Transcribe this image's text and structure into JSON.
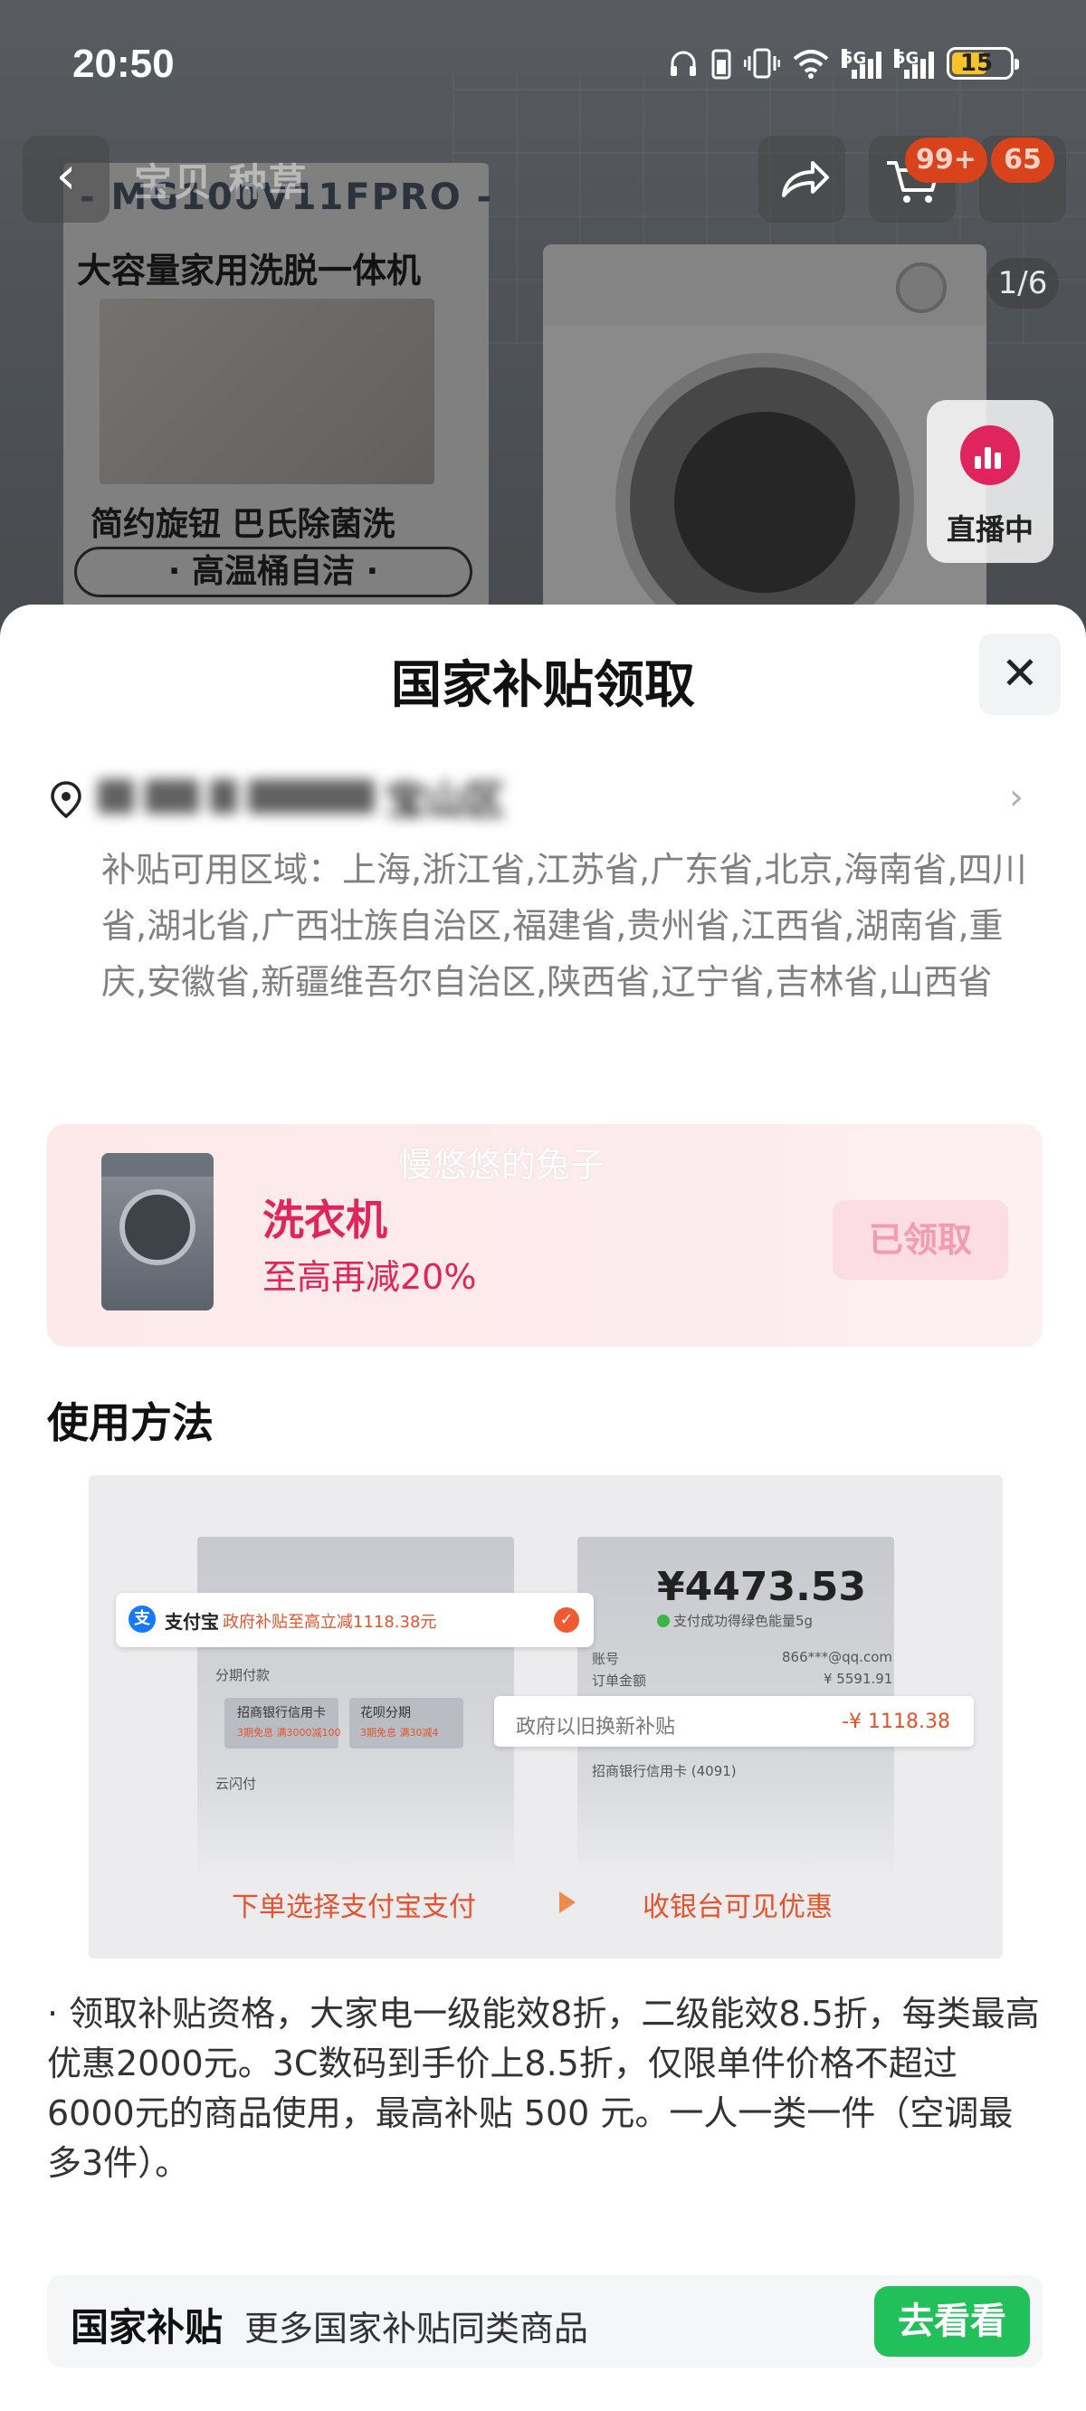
{
  "status_bar": {
    "time": "20:50",
    "network_1": "5G",
    "network_2": "5G",
    "battery": "15",
    "icons": [
      "headphones-icon",
      "phone-battery-icon",
      "vibrate-icon",
      "wifi-icon",
      "signal-icon",
      "signal-icon",
      "battery-icon"
    ]
  },
  "top_nav": {
    "tabs_text": "宝贝  种草",
    "cart_badge": "99+",
    "message_badge": "65",
    "page_indicator": "1/6",
    "live_label": "直播中"
  },
  "product_image": {
    "model": "- MG100V11FPRO -",
    "headline": "大容量家用洗脱一体机",
    "features": "简约旋钮  巴氏除菌洗",
    "pill": "· 高温桶自洁 ·"
  },
  "sheet": {
    "title": "国家补贴领取",
    "address_blurred": "宝山区",
    "region_text": "补贴可用区域：上海,浙江省,江苏省,广东省,北京,海南省,四川省,湖北省,广西壮族自治区,福建省,贵州省,江西省,湖南省,重庆,安徽省,新疆维吾尔自治区,陕西省,辽宁省,吉林省,山西省",
    "coupon": {
      "name": "洗衣机",
      "desc": "至高再减20%",
      "button": "已领取",
      "watermark": "慢悠悠的兔子"
    },
    "usage_title": "使用方法",
    "guide": {
      "alipay_name": "支付宝",
      "alipay_promo": "政府补贴至高立减1118.38元",
      "check": "✓",
      "installment": "分期付款",
      "bank_card": "招商银行信用卡",
      "bank_card_sub": "3期免息  满3000减100",
      "huabei": "花呗分期",
      "huabei_sub": "3期免息  满30减4",
      "cloud_pay": "云闪付",
      "amount": "¥4473.53",
      "amount_sub": "支付成功得绿色能量5g",
      "account_label": "账号",
      "account_value": "866***@qq.com",
      "order_label": "订单金额",
      "order_value": "¥ 5591.91",
      "subsidy_label": "政府以旧换新补贴",
      "subsidy_value": "-¥ 1118.38",
      "bank_line": "招商银行信用卡 (4091)",
      "step1": "下单选择支付宝支付",
      "step2": "收银台可见优惠"
    },
    "rules": "· 领取补贴资格，大家电一级能效8折，二级能效8.5折，每类最高优惠2000元。3C数码到手价上8.5折，仅限单件价格不超过6000元的商品使用，最高补贴 500 元。一人一类一件（空调最多3件）。",
    "more": {
      "tag": "国家补贴",
      "text": "更多国家补贴同类商品",
      "button": "去看看"
    }
  },
  "colors": {
    "accent_red": "#e0255b",
    "green": "#22c05a",
    "orange": "#e5532c"
  }
}
